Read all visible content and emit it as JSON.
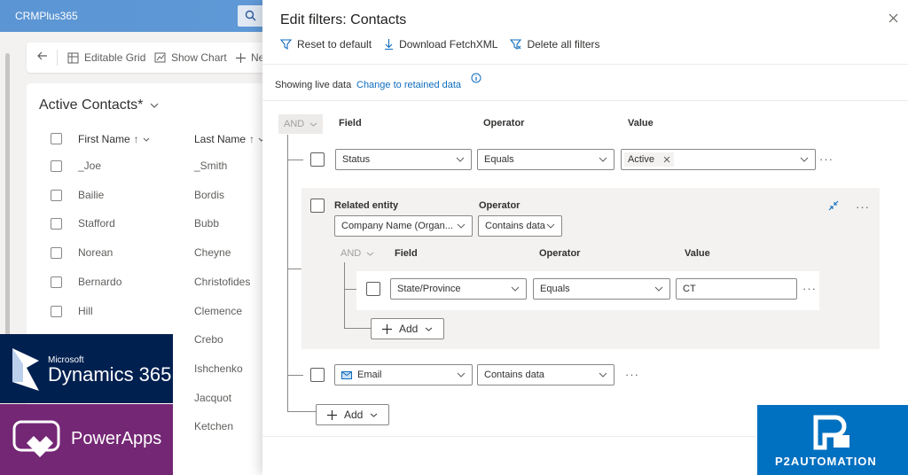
{
  "app": {
    "title": "CRMPlus365"
  },
  "commandbar": {
    "editable_grid": "Editable Grid",
    "show_chart": "Show Chart",
    "new": "Ne"
  },
  "grid": {
    "view_title": "Active Contacts*",
    "columns": [
      "First Name",
      "Last Name"
    ],
    "rows": [
      {
        "first": "_Joe",
        "last": "_Smith"
      },
      {
        "first": "Bailie",
        "last": "Bordis"
      },
      {
        "first": "Stafford",
        "last": "Bubb"
      },
      {
        "first": "Norean",
        "last": "Cheyne"
      },
      {
        "first": "Bernardo",
        "last": "Christofides"
      },
      {
        "first": "Hill",
        "last": "Clemence"
      },
      {
        "first": "",
        "last": "Crebo"
      },
      {
        "first": "",
        "last": "Ishchenko"
      },
      {
        "first": "",
        "last": "Jacquot"
      },
      {
        "first": "",
        "last": "Ketchen"
      }
    ]
  },
  "panel": {
    "title": "Edit filters: Contacts",
    "toolbar": {
      "reset": "Reset to default",
      "download": "Download FetchXML",
      "delete": "Delete all filters"
    },
    "live": {
      "text": "Showing live data",
      "link": "Change to retained data"
    },
    "and_label": "AND",
    "headers": {
      "field": "Field",
      "operator": "Operator",
      "value": "Value"
    },
    "row1": {
      "field": "Status",
      "operator": "Equals",
      "value_tag": "Active"
    },
    "related": {
      "label": "Related entity",
      "operator_label": "Operator",
      "entity": "Company Name (Organ...",
      "operator": "Contains data",
      "inner_and": "AND",
      "inner_headers": {
        "field": "Field",
        "operator": "Operator",
        "value": "Value"
      },
      "inner_row": {
        "field": "State/Province",
        "operator": "Equals",
        "value": "CT"
      },
      "add": "Add"
    },
    "row3": {
      "field": "Email",
      "operator": "Contains data"
    },
    "add": "Add"
  },
  "logos": {
    "dynamics_small": "Microsoft",
    "dynamics_big": "Dynamics 365",
    "powerapps": "PowerApps",
    "p2": "P2AUTOMATION"
  },
  "colors": {
    "accent": "#0f6cbd",
    "dynamics": "#002050",
    "powerapps": "#742774",
    "p2": "#0070c0"
  }
}
